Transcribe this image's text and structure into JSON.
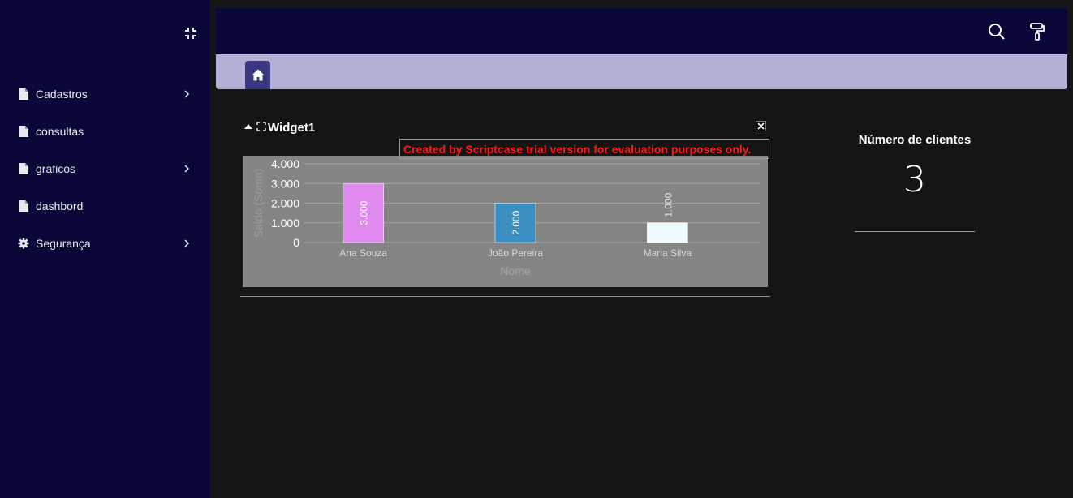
{
  "sidebar": {
    "items": [
      {
        "label": "Cadastros",
        "icon": "file-icon",
        "has_submenu": true
      },
      {
        "label": "consultas",
        "icon": "file-icon",
        "has_submenu": false
      },
      {
        "label": "graficos",
        "icon": "file-icon",
        "has_submenu": true
      },
      {
        "label": "dashbord",
        "icon": "file-icon",
        "has_submenu": false
      },
      {
        "label": "Segurança",
        "icon": "gear-icon",
        "has_submenu": true
      }
    ]
  },
  "widget": {
    "title": "Widget1",
    "trial_notice": "Created by Scriptcase trial version for evaluation purposes only."
  },
  "kpi": {
    "title": "Número de clientes",
    "value": "3"
  },
  "colors": {
    "sidebar_bg": "#0a0839",
    "tabbar_bg": "#b3b1d6",
    "home_tab_bg": "#3a3880",
    "trial_text": "#ff1a1a"
  },
  "chart_data": {
    "type": "bar",
    "categories": [
      "Ana Souza",
      "João Pereira",
      "Maria Silva"
    ],
    "values": [
      3000,
      2000,
      1000
    ],
    "value_labels": [
      "3.000",
      "2.000",
      "1.000"
    ],
    "bar_colors": [
      "#e08af0",
      "#3a8ec0",
      "#eefcff"
    ],
    "xlabel": "Nome",
    "ylabel": "Saldo (Soma)",
    "yticks": [
      "0",
      "1.000",
      "2.000",
      "3.000",
      "4.000"
    ],
    "ylim": [
      0,
      4000
    ],
    "grid": true
  }
}
